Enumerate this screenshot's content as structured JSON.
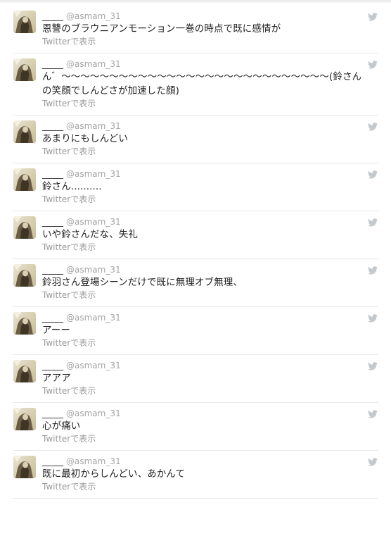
{
  "tweets": [
    {
      "name": "_____",
      "handle": "@asmam_31",
      "text": "恩讐のブラウニアンモーション一巻の時点で既に感情が",
      "link": "Twitterで表示"
    },
    {
      "name": "_____",
      "handle": "@asmam_31",
      "text": "ん゛〜〜〜〜〜〜〜〜〜〜〜〜〜〜〜〜〜〜〜〜〜〜〜〜〜〜〜〜(鈴さんの笑顔でしんどさが加速した顔)",
      "link": "Twitterで表示"
    },
    {
      "name": "_____",
      "handle": "@asmam_31",
      "text": "あまりにもしんどい",
      "link": "Twitterで表示"
    },
    {
      "name": "_____",
      "handle": "@asmam_31",
      "text": "鈴さん..........",
      "link": "Twitterで表示"
    },
    {
      "name": "_____",
      "handle": "@asmam_31",
      "text": "いや鈴さんだな、失礼",
      "link": "Twitterで表示"
    },
    {
      "name": "_____",
      "handle": "@asmam_31",
      "text": "鈴羽さん登場シーンだけで既に無理オブ無理、",
      "link": "Twitterで表示"
    },
    {
      "name": "_____",
      "handle": "@asmam_31",
      "text": "アーー",
      "link": "Twitterで表示"
    },
    {
      "name": "_____",
      "handle": "@asmam_31",
      "text": "アアア",
      "link": "Twitterで表示"
    },
    {
      "name": "_____",
      "handle": "@asmam_31",
      "text": "心が痛い",
      "link": "Twitterで表示"
    },
    {
      "name": "_____",
      "handle": "@asmam_31",
      "text": "既に最初からしんどい、あかんて",
      "link": "Twitterで表示"
    }
  ],
  "icons": {
    "avatar": "avatar-image",
    "brand": "twitter-bird-icon"
  },
  "colors": {
    "bird": "#c4c9cd",
    "muted": "#9a9a9a",
    "text": "#222222"
  }
}
